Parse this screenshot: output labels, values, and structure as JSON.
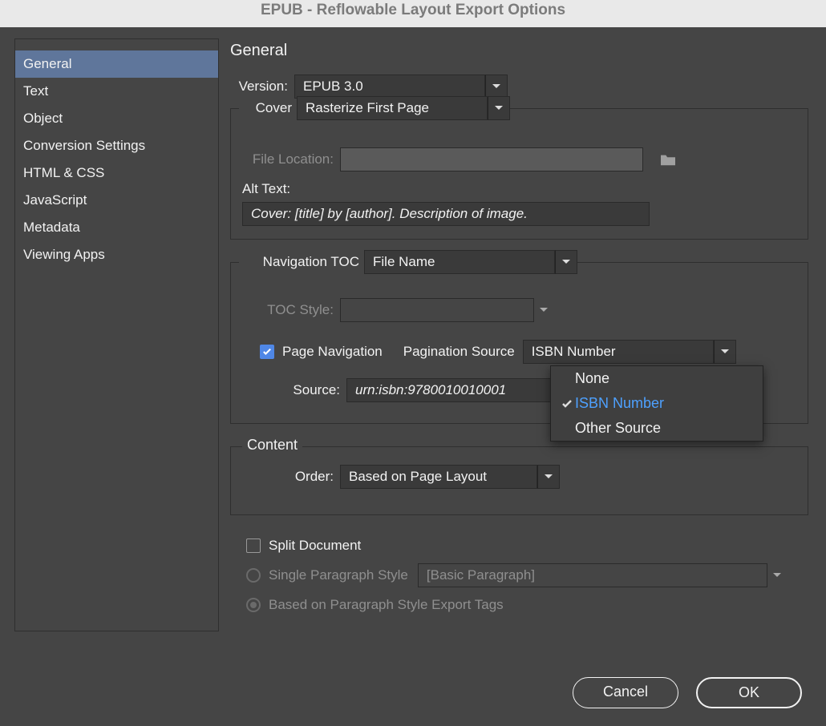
{
  "window": {
    "title": "EPUB - Reflowable Layout Export Options"
  },
  "sidebar": {
    "items": [
      {
        "label": "General"
      },
      {
        "label": "Text"
      },
      {
        "label": "Object"
      },
      {
        "label": "Conversion Settings"
      },
      {
        "label": "HTML & CSS"
      },
      {
        "label": "JavaScript"
      },
      {
        "label": "Metadata"
      },
      {
        "label": "Viewing Apps"
      }
    ]
  },
  "panel": {
    "heading": "General",
    "version_label": "Version:",
    "version_value": "EPUB 3.0",
    "cover_label": "Cover",
    "cover_value": "Rasterize First Page",
    "file_location_label": "File Location:",
    "file_location_value": "",
    "alt_text_label": "Alt Text:",
    "alt_text_value": "Cover: [title] by [author]. Description of image.",
    "nav_toc_label": "Navigation TOC",
    "nav_toc_value": "File Name",
    "toc_style_label": "TOC Style:",
    "toc_style_value": "",
    "page_nav_label": "Page Navigation",
    "page_nav_checked": true,
    "pagination_source_label": "Pagination Source",
    "pagination_source_value": "ISBN Number",
    "pagination_source_options": [
      "None",
      "ISBN Number",
      "Other Source"
    ],
    "source_label": "Source:",
    "source_value": "urn:isbn:9780010010001",
    "content_legend": "Content",
    "order_label": "Order:",
    "order_value": "Based on Page Layout",
    "split_doc_label": "Split Document",
    "split_doc_checked": false,
    "split_radio_single_label": "Single Paragraph Style",
    "split_radio_single_value": "[Basic Paragraph]",
    "split_radio_tags_label": "Based on Paragraph Style Export Tags"
  },
  "footer": {
    "cancel": "Cancel",
    "ok": "OK"
  }
}
